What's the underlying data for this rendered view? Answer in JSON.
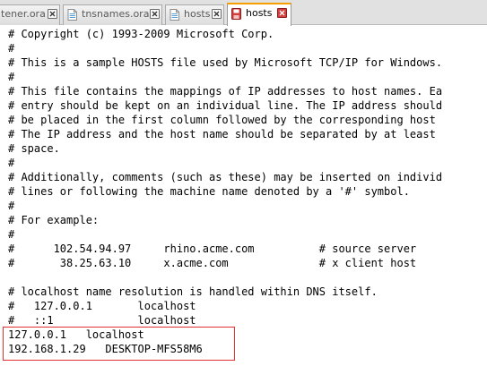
{
  "tabs": [
    {
      "label": "tener.ora",
      "active": false,
      "icon": "file-icon"
    },
    {
      "label": "tnsnames.ora",
      "active": false,
      "icon": "file-icon"
    },
    {
      "label": "hosts",
      "active": false,
      "icon": "file-icon"
    },
    {
      "label": "hosts",
      "active": true,
      "icon": "save-file-icon"
    }
  ],
  "colors": {
    "active_tab_accent": "#f4a100",
    "active_close": "#d44040",
    "highlight_border": "#e03030"
  },
  "editor": {
    "lines": [
      "# Copyright (c) 1993-2009 Microsoft Corp.",
      "#",
      "# This is a sample HOSTS file used by Microsoft TCP/IP for Windows.",
      "#",
      "# This file contains the mappings of IP addresses to host names. Ea",
      "# entry should be kept on an individual line. The IP address should",
      "# be placed in the first column followed by the corresponding host",
      "# The IP address and the host name should be separated by at least",
      "# space.",
      "#",
      "# Additionally, comments (such as these) may be inserted on individ",
      "# lines or following the machine name denoted by a '#' symbol.",
      "#",
      "# For example:",
      "#",
      "#      102.54.94.97     rhino.acme.com          # source server",
      "#       38.25.63.10     x.acme.com              # x client host",
      "",
      "# localhost name resolution is handled within DNS itself.",
      "#   127.0.0.1       localhost",
      "#   ::1             localhost",
      "127.0.0.1   localhost",
      "192.168.1.29   DESKTOP-MFS58M6"
    ]
  }
}
